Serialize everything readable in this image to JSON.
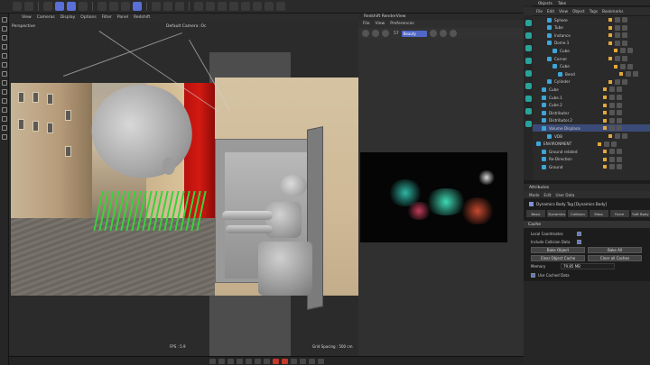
{
  "toolbar": {
    "active_tools": 3
  },
  "viewport": {
    "menu": [
      "View",
      "Cameras",
      "Display",
      "Options",
      "Filter",
      "Panel",
      "Redshift"
    ],
    "camera_label": "Perspective",
    "default_camera": "Default Camera :Oc",
    "fps": "FPS : 5.9",
    "grid_spacing": "Grid Spacing : 500 cm"
  },
  "renderview": {
    "title": "Redshift RenderView",
    "menu": [
      "File",
      "View",
      "Preferences"
    ],
    "frame": "57",
    "mode": "Beauty"
  },
  "objects": {
    "tabs": [
      "Objects",
      "Take"
    ],
    "menu": [
      "File",
      "Edit",
      "View",
      "Object",
      "Tags",
      "Bookmarks"
    ],
    "rows": [
      {
        "name": "Sphere",
        "indent": 2
      },
      {
        "name": "Tube",
        "indent": 2
      },
      {
        "name": "Instance",
        "indent": 2
      },
      {
        "name": "Dome.1",
        "indent": 2
      },
      {
        "name": "Cube",
        "indent": 3
      },
      {
        "name": "Corner",
        "indent": 2
      },
      {
        "name": "Cube",
        "indent": 3
      },
      {
        "name": "Bend",
        "indent": 4
      },
      {
        "name": "Cylinder",
        "indent": 2
      },
      {
        "name": "Cube",
        "indent": 1
      },
      {
        "name": "Cube.1",
        "indent": 1
      },
      {
        "name": "Cube.2",
        "indent": 1
      },
      {
        "name": "Distributor",
        "indent": 1
      },
      {
        "name": "Distributor.2",
        "indent": 1
      },
      {
        "name": "Volume Displace",
        "indent": 1,
        "selected": true
      },
      {
        "name": "VDB",
        "indent": 2
      },
      {
        "name": "ENVIRONMENT",
        "indent": 0
      },
      {
        "name": "Ground related",
        "indent": 1
      },
      {
        "name": "Re-Direction",
        "indent": 1
      },
      {
        "name": "Ground",
        "indent": 1
      }
    ]
  },
  "attributes": {
    "title": "Attributes",
    "menu": [
      "Mode",
      "Edit",
      "User Data"
    ],
    "object_label": "Dynamics Body Tag [Dynamics Body]",
    "tabs": [
      "Basic",
      "Dynamics",
      "Collision",
      "Mass",
      "Force",
      "Soft Body"
    ],
    "section": "Cache",
    "local_coords": "Local Coordinates",
    "include_collision": "Include Collision Data",
    "bake_object": "Bake Object",
    "bake_all": "Bake All",
    "clear_object_cache": "Clear Object Cache",
    "clear_all_caches": "Clear all Caches",
    "memory_label": "Memory",
    "memory_value": "79.85 MB",
    "use_cached_data": "Use Cached Data"
  },
  "colors": {
    "accent": "#5a6fd8",
    "emitter": "#39d23a",
    "selected_row": "#3b4b78",
    "door": "#c81a12"
  }
}
